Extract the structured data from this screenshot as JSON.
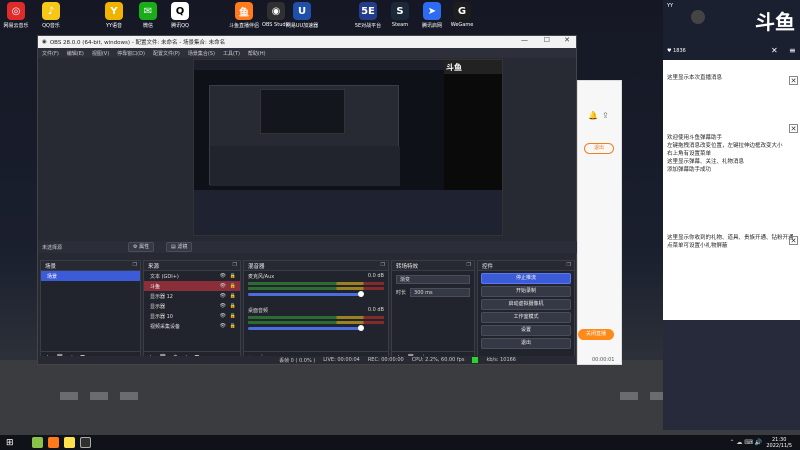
{
  "desktop_icons": [
    {
      "label": "网易云音乐",
      "color": "#e02b2b",
      "glyph": "◎"
    },
    {
      "label": "QQ音乐",
      "color": "#f5c718",
      "glyph": "♪"
    },
    {
      "label": "YY语音",
      "color": "#f0b400",
      "glyph": "Y"
    },
    {
      "label": "微信",
      "color": "#1aad19",
      "glyph": "✉"
    },
    {
      "label": "腾讯QQ",
      "color": "#ffffff",
      "glyph": "Q"
    },
    {
      "label": "斗鱼直播伴侣",
      "color": "#ff7a1a",
      "glyph": "鱼"
    },
    {
      "label": "OBS Studio",
      "color": "#303030",
      "glyph": "◉"
    },
    {
      "label": "网易UU加速器",
      "color": "#1f4fa8",
      "glyph": "U"
    },
    {
      "label": "5E对战平台",
      "color": "#233c8c",
      "glyph": "5E"
    },
    {
      "label": "Steam",
      "color": "#1b2838",
      "glyph": "S"
    },
    {
      "label": "腾讯启网",
      "color": "#2d6bf0",
      "glyph": "➤"
    },
    {
      "label": "WeGame",
      "color": "#1d1d1d",
      "glyph": "G"
    }
  ],
  "obs": {
    "title": "OBS 28.0.0 (64-bit, windows) - 配置文件: 未命名 - 场景集合: 未命名",
    "menu": [
      "文件(F)",
      "编辑(E)",
      "视图(V)",
      "停靠窗口(D)",
      "配置文件(P)",
      "场景集合(S)",
      "工具(T)",
      "帮助(H)"
    ],
    "window_controls": {
      "minimize": "—",
      "maximize": "☐",
      "close": "✕"
    },
    "no_source_label": "未选择源",
    "properties_label": "属性",
    "filters_label": "滤镜",
    "scenes": {
      "title": "场景",
      "items": [
        "场景"
      ]
    },
    "sources": {
      "title": "来源",
      "items": [
        "文本 (GDI+)",
        "斗鱼",
        "显示器 12",
        "显示器",
        "显示器 10",
        "视频采集设备"
      ]
    },
    "mixer": {
      "title": "混音器",
      "channels": [
        {
          "name": "麦克风/Aux",
          "db": "0.0 dB"
        },
        {
          "name": "桌面音频",
          "db": "0.0 dB"
        }
      ]
    },
    "transitions": {
      "title": "转场特效",
      "type": "渐变",
      "duration_label": "时长",
      "duration": "300 ms"
    },
    "controls": {
      "title": "控件",
      "buttons": [
        "停止推流",
        "开始录制",
        "启动虚拟摄像机",
        "工作室模式",
        "设置",
        "退出"
      ]
    },
    "status": {
      "dropped": "丢帧 0 ( 0.0% )",
      "live": "LIVE: 00:00:04",
      "rec": "REC: 00:00:00",
      "cpu": "CPU: 2.2%, 60.00 fps",
      "kbps": "kb/s: 10166"
    }
  },
  "right_panel": {
    "logo_text": "斗鱼",
    "user": "YY",
    "likes": "1836",
    "notice": "这里显示本次直播消息",
    "help_lines": [
      "欢迎使用斗鱼弹幕助手",
      "左键拖拽消息改变位置，左键拉伸边框改变大小",
      "右上角有设置菜单",
      "这里显示弹幕、关注、礼物消息",
      "添加弹幕助手成功"
    ],
    "gift_notice_lines": [
      "这里显示你收到的礼物、道具、贵族开通、钻粉开通",
      "点菜单可设置小礼物屏蔽"
    ],
    "time_readout": "00:00:01",
    "exit_button": "退出",
    "live_button": "关闭直播"
  },
  "taskbar": {
    "time": "21:30",
    "date": "2022/11/5"
  },
  "colors": {
    "accent": "#3b5bd8",
    "live": "#ff8a1a"
  }
}
